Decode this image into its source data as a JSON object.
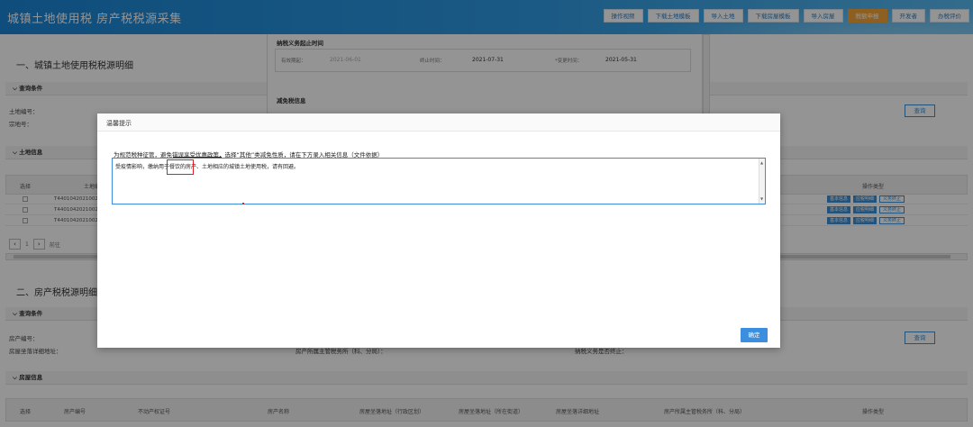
{
  "header": {
    "title": "城镇土地使用税 房产税税源采集",
    "nav": [
      "操作视频",
      "下载土地模板",
      "导入土地",
      "下载房屋模板",
      "导入房屋",
      "税额申报",
      "开发者",
      "办税评价"
    ],
    "active_index": 5
  },
  "section1": {
    "title": "一、城镇土地使用税税源明细",
    "query_head": "查询条件",
    "label_land_no": "土地编号：",
    "label_parcel_no": "宗地号：",
    "query_button": "查询",
    "land_info_head": "土地信息",
    "col_select": "选择",
    "col_land_no": "土地编",
    "col_ops": "操作类型",
    "rows": [
      "T4401042021002685",
      "T4401042021002684",
      "T4401042021002685"
    ],
    "op_labels": [
      "基本信息",
      "应税明细",
      "义务终止"
    ],
    "pager_page": "1",
    "pager_text": "前往"
  },
  "section2": {
    "title": "二、房产税税源明细",
    "query_head": "查询条件",
    "label_house_no": "房产编号：",
    "label_addr": "房屋坐落详细地址：",
    "label_tax_office": "房产所属主管税务所（科、分局）：",
    "label_duty_end": "纳税义务是否终止：",
    "query_button": "查询",
    "house_info_head": "房屋信息",
    "cols": [
      "选择",
      "房产编号",
      "不动产权证号",
      "房产名称",
      "房屋坐落地址（行政区划）",
      "房屋坐落地址（所在街道）",
      "房屋坐落详细地址",
      "房产所属主管税务所（科、分局）",
      "操作类型"
    ]
  },
  "behind_form": {
    "duty_title": "纳税义务起止时间",
    "label_valid_start": "有效期起：",
    "valid_start": "2021-06-01",
    "label_end_time": "终止时间：",
    "end_time": "2021-07-31",
    "label_change_time": "*变更时间：",
    "change_time": "2021-05-31",
    "reduce_title": "减免税信息"
  },
  "modal": {
    "title": "温馨提示",
    "hint": "为规范税种征管，避免错误享受优惠政策，选择“其他”类减免性质，请在下方录入相关信息（文件依据）",
    "textarea_value": "受疫情影响，缴纳用于餐饮的房产、土地相应的城镇土地使用税，请有回避。",
    "confirm": "确定"
  },
  "colors": {
    "header": "#2f9be4",
    "accent": "#3c8fde",
    "active_nav": "#f3a63a",
    "highlight": "#e02020"
  }
}
